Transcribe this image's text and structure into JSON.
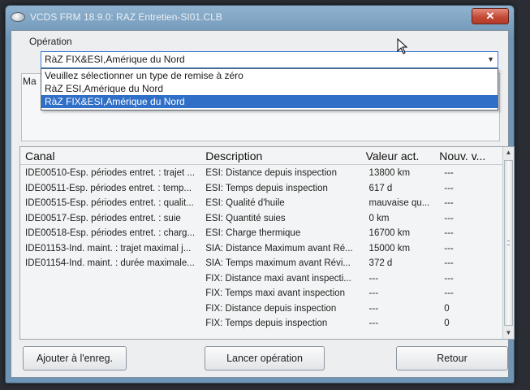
{
  "window": {
    "title": "VCDS FRM 18.9.0:  RAZ Entretien-SI01.CLB"
  },
  "operation": {
    "group_label": "Opération",
    "selected": "RàZ FIX&ESI,Amérique du Nord",
    "options": [
      "Veuillez sélectionner un type de remise à zéro",
      "RàZ ESI,Amérique du Nord",
      "RàZ FIX&ESI,Amérique du Nord"
    ],
    "selected_index": 2
  },
  "ma_label": "Ma",
  "table": {
    "headers": [
      "Canal",
      "Description",
      "Valeur act.",
      "Nouv. v..."
    ],
    "rows": [
      [
        "IDE00510-Esp. périodes entret. : trajet ...",
        "ESI: Distance depuis inspection",
        "13800 km",
        "---"
      ],
      [
        "IDE00511-Esp. périodes entret. : temp...",
        "ESI: Temps depuis inspection",
        "617 d",
        "---"
      ],
      [
        "IDE00515-Esp. périodes entret. : qualit...",
        "ESI: Qualité d'huile",
        "mauvaise qu...",
        "---"
      ],
      [
        "IDE00517-Esp. périodes entret. : suie",
        "ESI: Quantité suies",
        "0 km",
        "---"
      ],
      [
        "IDE00518-Esp. périodes entret. : charg...",
        "ESI: Charge thermique",
        "16700 km",
        "---"
      ],
      [
        "IDE01153-Ind. maint. : trajet maximal j...",
        "SIA: Distance Maximum avant Ré...",
        "15000 km",
        "---"
      ],
      [
        "IDE01154-Ind. maint. : durée maximale...",
        "SIA: Temps maximum avant Révi...",
        "372 d",
        "---"
      ],
      [
        "",
        "FIX: Distance maxi avant inspecti...",
        "---",
        "---"
      ],
      [
        "",
        "FIX: Temps maxi avant inspection",
        "---",
        "---"
      ],
      [
        "",
        "FIX: Distance depuis inspection",
        "---",
        "0"
      ],
      [
        "",
        "FIX: Temps depuis inspection",
        "---",
        "0"
      ]
    ]
  },
  "buttons": {
    "add": "Ajouter à l'enreg.",
    "launch": "Lancer opération",
    "back": "Retour"
  },
  "close_glyph": "✕"
}
